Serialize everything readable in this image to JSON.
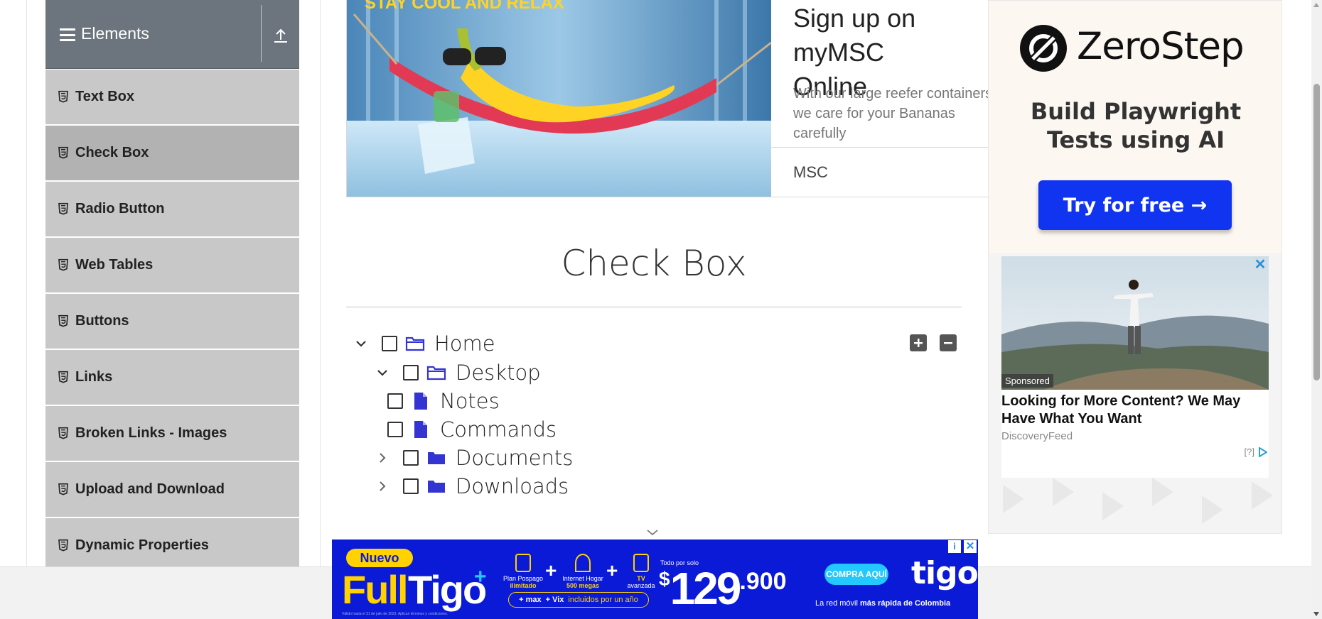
{
  "sidebar": {
    "group_title": "Elements",
    "items": [
      {
        "label": "Text Box"
      },
      {
        "label": "Check Box"
      },
      {
        "label": "Radio Button"
      },
      {
        "label": "Web Tables"
      },
      {
        "label": "Buttons"
      },
      {
        "label": "Links"
      },
      {
        "label": "Broken Links - Images"
      },
      {
        "label": "Upload and Download"
      },
      {
        "label": "Dynamic Properties"
      }
    ],
    "active_item": "Check Box"
  },
  "top_ad": {
    "image_text": "STAY COOL AND RELAX",
    "title": "Sign up on myMSC\nOnline",
    "body": "With our large reefer containers\nwe care for your Bananas carefully",
    "brand": "MSC"
  },
  "main": {
    "page_title": "Check Box"
  },
  "tree": {
    "nodes": [
      {
        "label": "Home",
        "expanded": true,
        "icon": "folder-open-icon"
      },
      {
        "label": "Desktop",
        "expanded": true,
        "icon": "folder-open-icon"
      },
      {
        "label": "Notes",
        "icon": "file-icon"
      },
      {
        "label": "Commands",
        "icon": "file-icon"
      },
      {
        "label": "Documents",
        "expanded": false,
        "icon": "folder-closed-icon"
      },
      {
        "label": "Downloads",
        "expanded": false,
        "icon": "folder-closed-icon"
      }
    ],
    "expand_all_label": "+",
    "collapse_all_label": "−",
    "icon_color": "#3434d3"
  },
  "right_ad": {
    "brand": "ZeroStep",
    "tagline": "Build Playwright\nTests using AI",
    "cta": "Try for free →",
    "cta_color": "#1134f0",
    "card": {
      "sponsored": "Sponsored",
      "headline": "Looking for More Content? We May\nHave What You Want",
      "source": "DiscoveryFeed",
      "adchoice": "[?]",
      "close": "✕"
    }
  },
  "bottom_ad": {
    "badge": "Nuevo",
    "product_full": "Full",
    "product_tigo": "Tigo",
    "plus": "+",
    "features": [
      {
        "line1": "Plan Pospago",
        "line2": "ilimitado"
      },
      {
        "line1": "Internet Hogar",
        "line2": "500 megas"
      },
      {
        "line1": "TV",
        "line2": "avanzada"
      }
    ],
    "pill_a": "+ max",
    "pill_b": "+ Vix",
    "pill_c": "incluidos por un año",
    "price_label": "Todo por solo",
    "price_currency": "$",
    "price_main": "129",
    "price_decimals": ".900",
    "cta": "COMPRA AQUÍ",
    "logo": "tigo",
    "slogan_a": "La red móvil ",
    "slogan_b": "más rápida de Colombia",
    "legal": "Válido hasta el 31 de julio de 2023. Aplican términos y condiciones.",
    "info": "i",
    "close": "✕",
    "color": "#0a1ad6",
    "accent": "#ffd200"
  }
}
